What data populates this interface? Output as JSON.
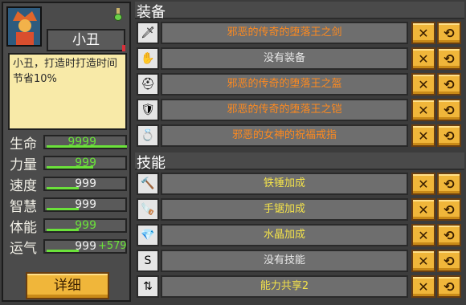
{
  "character": {
    "name": "小丑",
    "description": "小丑，打造时打造时间节省10%",
    "detail_button": "详细"
  },
  "stats": [
    {
      "label": "生命",
      "value": "9999",
      "bonus": "",
      "color": "#6be23a"
    },
    {
      "label": "力量",
      "value": "999",
      "bonus": "",
      "color": "#6be23a"
    },
    {
      "label": "速度",
      "value": "999",
      "bonus": "",
      "color": "#f0f0f0"
    },
    {
      "label": "智慧",
      "value": "999",
      "bonus": "",
      "color": "#f0f0f0"
    },
    {
      "label": "体能",
      "value": "999",
      "bonus": "",
      "color": "#6be23a"
    },
    {
      "label": "运气",
      "value": "999",
      "bonus": "+579",
      "color": "#f0f0f0"
    }
  ],
  "equipment": {
    "title": "装备",
    "items": [
      {
        "icon": "sword-icon",
        "name": "邪恶的传奇的堕落王之剑",
        "color": "orange"
      },
      {
        "icon": "glove-icon",
        "name": "没有装备",
        "color": "grey"
      },
      {
        "icon": "helmet-icon",
        "name": "邪恶的传奇的堕落王之盔",
        "color": "orange"
      },
      {
        "icon": "armor-icon",
        "name": "邪恶的传奇的堕落王之铠",
        "color": "orange"
      },
      {
        "icon": "ring-icon",
        "name": "邪恶的女神的祝福戒指",
        "color": "orange"
      }
    ]
  },
  "skills": {
    "title": "技能",
    "items": [
      {
        "icon": "hammer-icon",
        "name": "铁锤加成",
        "color": "yellow"
      },
      {
        "icon": "saw-icon",
        "name": "手锯加成",
        "color": "yellow"
      },
      {
        "icon": "crystal-icon",
        "name": "水晶加成",
        "color": "yellow"
      },
      {
        "icon": "skill-empty-icon",
        "name": "没有技能",
        "color": "grey"
      },
      {
        "icon": "share-icon",
        "name": "能力共享2",
        "color": "yellow"
      }
    ]
  },
  "button_glyphs": {
    "remove": "✕",
    "replace": "⟲"
  }
}
